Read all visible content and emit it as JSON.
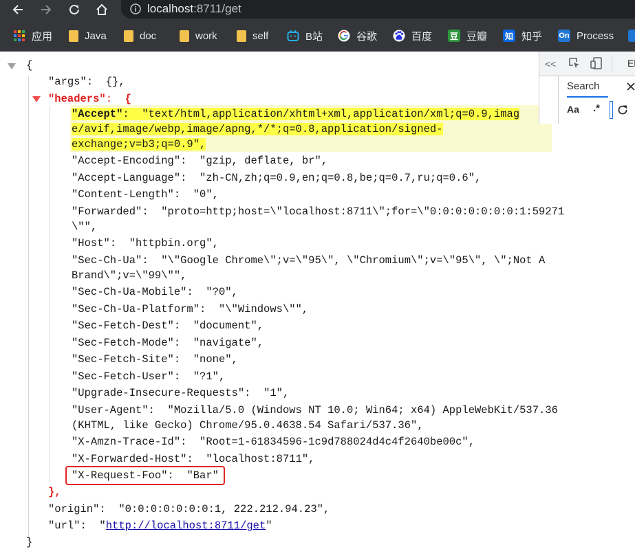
{
  "toolbar": {
    "url_host": "localhost",
    "url_rest": ":8711/get"
  },
  "bookmarks": [
    {
      "label": "应用",
      "icon": "apps-grid-icon"
    },
    {
      "label": "Java",
      "icon": "folder-icon"
    },
    {
      "label": "doc",
      "icon": "folder-icon"
    },
    {
      "label": "work",
      "icon": "folder-icon"
    },
    {
      "label": "self",
      "icon": "folder-icon"
    },
    {
      "label": "B站",
      "icon": "bilibili-icon"
    },
    {
      "label": "谷歌",
      "icon": "google-icon"
    },
    {
      "label": "百度",
      "icon": "baidu-icon"
    },
    {
      "label": "豆瓣",
      "icon": "douban-icon"
    },
    {
      "label": "知乎",
      "icon": "zhihu-icon"
    },
    {
      "label": "Process",
      "icon": "processon-icon"
    }
  ],
  "icons": {
    "douban_glyph": "豆",
    "zhihu_glyph": "知",
    "processon_glyph": "On"
  },
  "json": {
    "open_brace": "{",
    "close_brace": "}",
    "args_key": "\"args\"",
    "args_value": "{},",
    "headers_key": "\"headers\"",
    "headers_open": "{",
    "headers_close": "},",
    "headers": [
      {
        "k": "\"Accept\"",
        "v": "\"text/html,application/xhtml+xml,application/xml;q=0.9,image/avif,image/webp,image/apng,*/*;q=0.8,application/signed-exchange;v=b3;q=0.9\","
      },
      {
        "k": "\"Accept-Encoding\"",
        "v": "\"gzip, deflate, br\","
      },
      {
        "k": "\"Accept-Language\"",
        "v": "\"zh-CN,zh;q=0.9,en;q=0.8,be;q=0.7,ru;q=0.6\","
      },
      {
        "k": "\"Content-Length\"",
        "v": "\"0\","
      },
      {
        "k": "\"Forwarded\"",
        "v": "\"proto=http;host=\\\"localhost:8711\\\";for=\\\"0:0:0:0:0:0:0:1:59271\\\"\","
      },
      {
        "k": "\"Host\"",
        "v": "\"httpbin.org\","
      },
      {
        "k": "\"Sec-Ch-Ua\"",
        "v": "\"\\\"Google Chrome\\\";v=\\\"95\\\", \\\"Chromium\\\";v=\\\"95\\\", \\\";Not A Brand\\\";v=\\\"99\\\"\","
      },
      {
        "k": "\"Sec-Ch-Ua-Mobile\"",
        "v": "\"?0\","
      },
      {
        "k": "\"Sec-Ch-Ua-Platform\"",
        "v": "\"\\\"Windows\\\"\","
      },
      {
        "k": "\"Sec-Fetch-Dest\"",
        "v": "\"document\","
      },
      {
        "k": "\"Sec-Fetch-Mode\"",
        "v": "\"navigate\","
      },
      {
        "k": "\"Sec-Fetch-Site\"",
        "v": "\"none\","
      },
      {
        "k": "\"Sec-Fetch-User\"",
        "v": "\"?1\","
      },
      {
        "k": "\"Upgrade-Insecure-Requests\"",
        "v": "\"1\","
      },
      {
        "k": "\"User-Agent\"",
        "v": "\"Mozilla/5.0 (Windows NT 10.0; Win64; x64) AppleWebKit/537.36 (KHTML, like Gecko) Chrome/95.0.4638.54 Safari/537.36\","
      },
      {
        "k": "\"X-Amzn-Trace-Id\"",
        "v": "\"Root=1-61834596-1c9d788024d4c4f2640be00c\","
      },
      {
        "k": "\"X-Forwarded-Host\"",
        "v": "\"localhost:8711\","
      },
      {
        "k": "\"X-Request-Foo\"",
        "v": "\"Bar\""
      }
    ],
    "accept_lines": [
      "\"text/html,application/xhtml+xml,application/xml;q=0.9,imag",
      "e/avif,image/webp,image/apng,*/*;q=0.8,application/signed-",
      "exchange;v=b3;q=0.9\","
    ],
    "forwarded_lines": [
      "\"proto=http;host=\\\"localhost:8711\\\";for=\\\"0:0:0:0:0:0:0:1:59271",
      "\\\"\","
    ],
    "secchua_lines": [
      "\"\\\"Google Chrome\\\";v=\\\"95\\\", \\\"Chromium\\\";v=\\\"95\\\", \\\";Not A",
      "Brand\\\";v=\\\"99\\\"\","
    ],
    "ua_lines": [
      "\"Mozilla/5.0 (Windows NT 10.0; Win64; x64) AppleWebKit/537.36",
      "(KHTML, like Gecko) Chrome/95.0.4638.54 Safari/537.36\","
    ],
    "origin_key": "\"origin\"",
    "origin_value": "\"0:0:0:0:0:0:0:1, 222.212.94.23\",",
    "url_key": "\"url\"",
    "url_quote_open": "\"",
    "url_value": "http://localhost:8711/get",
    "url_quote_close": "\""
  },
  "devtools": {
    "collapse_label": "<<",
    "tab_label_partial": "El",
    "search_label": "Search",
    "case_label": "Aa",
    "regex_label": ".*"
  },
  "colors": {
    "highlight": "#fdff47",
    "annotation_box": "#e32323",
    "headers_key": "#e0201f"
  }
}
